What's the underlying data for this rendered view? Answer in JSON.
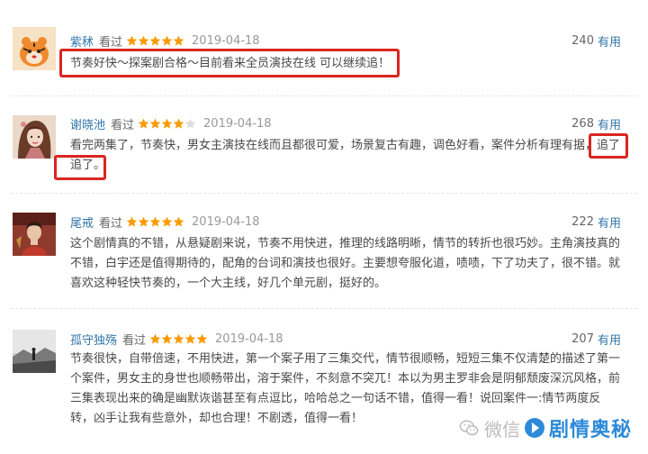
{
  "reviews": [
    {
      "user": "紫秫",
      "watched": "看过",
      "rating": 5,
      "date": "2019-04-18",
      "votes": "240",
      "useful": "有用",
      "lines": [
        "节奏好快～探案剧合格～目前看来全员演技在线 可以继续追！"
      ]
    },
    {
      "user": "谢晓池",
      "watched": "看过",
      "rating": 4,
      "date": "2019-04-18",
      "votes": "268",
      "useful": "有用",
      "lines": [
        "看完两集了，节奏快，男女主演技在线而且都很可爱，场景复古有趣，调色好看，案件分析有理有据，追了",
        "追了。"
      ]
    },
    {
      "user": "尾戒",
      "watched": "看过",
      "rating": 5,
      "date": "2019-04-18",
      "votes": "222",
      "useful": "有用",
      "lines": [
        "这个剧情真的不错，从悬疑剧来说，节奏不用快进，推理的线路明晰，情节的转折也很巧妙。主角演技真的",
        "不错，白宇还是值得期待的，配角的台词和演技也很好。主要想夸服化道，啧啧，下了功夫了，很不错。就",
        "喜欢这种轻快节奏的，一个大主线，好几个单元剧，挺好的。"
      ]
    },
    {
      "user": "孤守独殇",
      "watched": "看过",
      "rating": 5,
      "date": "2019-04-18",
      "votes": "207",
      "useful": "有用",
      "lines": [
        "节奏很快，自带倍速，不用快进，第一个案子用了三集交代，情节很顺畅，短短三集不仅清楚的描述了第一",
        "个案件，男女主的身世也顺畅带出，溶于案件，不刻意不突兀！本以为男主罗非会是阴郁颓废深沉风格，前",
        "三集表现出来的确是幽默诙谐甚至有点逗比，哈哈总之一句话不错，值得一看！说回案件一:情节两度反",
        "转，凶手让我有些意外，却也合理！不剧透，值得一看！"
      ]
    }
  ],
  "watermark": {
    "prefix": "微信",
    "brand": "剧情奥秘",
    "icon": "wechat-icon"
  },
  "colors": {
    "username": "#3377aa",
    "star": "#f99b01",
    "star_empty": "#dddddd",
    "highlight": "#d9261f",
    "brand": "#2d8ad8"
  }
}
